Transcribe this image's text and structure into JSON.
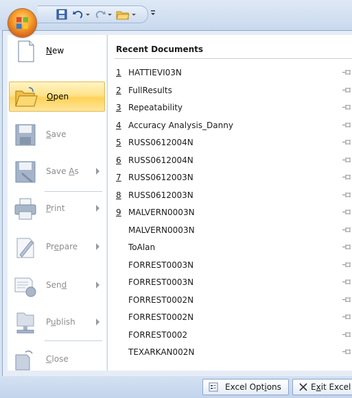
{
  "quick_access": {
    "items": [
      {
        "name": "save-icon"
      },
      {
        "name": "undo-icon"
      },
      {
        "name": "redo-icon"
      },
      {
        "name": "open-folder-icon"
      },
      {
        "name": "customize-icon"
      }
    ]
  },
  "office_menu": {
    "items": [
      {
        "key": "new",
        "pre": "",
        "acc": "N",
        "post": "ew",
        "enabled": true,
        "submenu": false,
        "icon": "new-document-icon"
      },
      {
        "key": "open",
        "pre": "",
        "acc": "O",
        "post": "pen",
        "enabled": true,
        "submenu": false,
        "icon": "open-folder-icon",
        "selected": true
      },
      {
        "key": "save",
        "pre": "",
        "acc": "S",
        "post": "ave",
        "enabled": false,
        "submenu": false,
        "icon": "save-disk-icon"
      },
      {
        "key": "save_as",
        "pre": "Save ",
        "acc": "A",
        "post": "s",
        "enabled": false,
        "submenu": true,
        "icon": "save-as-icon"
      },
      {
        "key": "print",
        "pre": "",
        "acc": "P",
        "post": "rint",
        "enabled": false,
        "submenu": true,
        "icon": "printer-icon"
      },
      {
        "key": "prepare",
        "pre": "Pr",
        "acc": "e",
        "post": "pare",
        "enabled": false,
        "submenu": true,
        "icon": "prepare-icon"
      },
      {
        "key": "send",
        "pre": "Sen",
        "acc": "d",
        "post": "",
        "enabled": false,
        "submenu": true,
        "icon": "send-icon"
      },
      {
        "key": "publish",
        "pre": "P",
        "acc": "u",
        "post": "blish",
        "enabled": false,
        "submenu": true,
        "icon": "publish-icon"
      },
      {
        "key": "close",
        "pre": "",
        "acc": "C",
        "post": "lose",
        "enabled": false,
        "submenu": false,
        "icon": "close-document-icon"
      }
    ]
  },
  "recent": {
    "header": "Recent Documents",
    "items": [
      {
        "num": "1",
        "name": "HATTIEVI03N"
      },
      {
        "num": "2",
        "name": "FullResults"
      },
      {
        "num": "3",
        "name": "Repeatability"
      },
      {
        "num": "4",
        "name": "Accuracy Analysis_Danny"
      },
      {
        "num": "5",
        "name": "RUSS0612004N"
      },
      {
        "num": "6",
        "name": "RUSS0612004N"
      },
      {
        "num": "7",
        "name": "RUSS0612003N"
      },
      {
        "num": "8",
        "name": "RUSS0612003N"
      },
      {
        "num": "9",
        "name": "MALVERN0003N"
      },
      {
        "num": "",
        "name": "MALVERN0003N"
      },
      {
        "num": "",
        "name": "ToAlan"
      },
      {
        "num": "",
        "name": "FORREST0003N"
      },
      {
        "num": "",
        "name": "FORREST0003N"
      },
      {
        "num": "",
        "name": "FORREST0002N"
      },
      {
        "num": "",
        "name": "FORREST0002N"
      },
      {
        "num": "",
        "name": "FORREST0002"
      },
      {
        "num": "",
        "name": "TEXARKAN002N"
      }
    ]
  },
  "bottom": {
    "options": {
      "pre": "Excel Opt",
      "acc": "i",
      "post": "ons"
    },
    "exit": {
      "pre": "E",
      "acc": "x",
      "post": "it Excel"
    }
  }
}
